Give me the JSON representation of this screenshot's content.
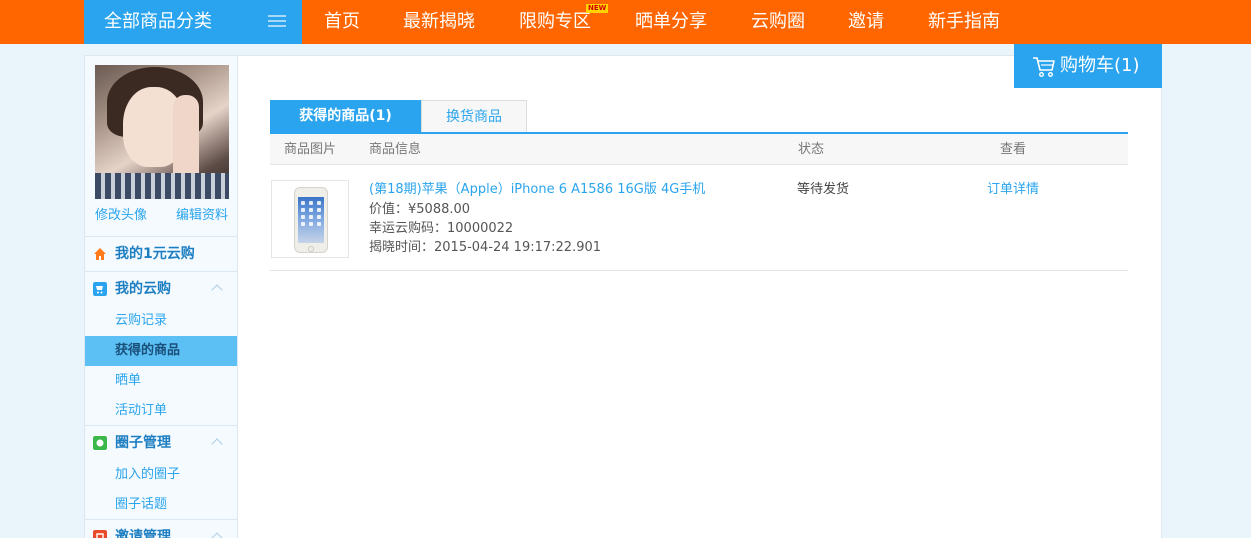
{
  "topbar": {
    "category_label": "全部商品分类",
    "nav": [
      {
        "label": "首页"
      },
      {
        "label": "最新揭晓"
      },
      {
        "label": "限购专区",
        "badge": "NEW"
      },
      {
        "label": "晒单分享"
      },
      {
        "label": "云购圈"
      },
      {
        "label": "邀请"
      },
      {
        "label": "新手指南"
      }
    ],
    "cart_label": "购物车(1)",
    "colors": {
      "bar": "#ff6600",
      "accent": "#2aa4ee"
    }
  },
  "sidebar": {
    "edit_avatar": "修改头像",
    "edit_profile": "编辑资料",
    "sections": [
      {
        "label": "我的1元云购",
        "icon": "home-icon",
        "items": []
      },
      {
        "label": "我的云购",
        "icon": "cart-icon",
        "items": [
          {
            "label": "云购记录"
          },
          {
            "label": "获得的商品",
            "active": true
          },
          {
            "label": "晒单"
          },
          {
            "label": "活动订单"
          }
        ]
      },
      {
        "label": "圈子管理",
        "icon": "circle-icon",
        "items": [
          {
            "label": "加入的圈子"
          },
          {
            "label": "圈子话题"
          }
        ]
      },
      {
        "label": "邀请管理",
        "icon": "invite-icon",
        "items": []
      }
    ]
  },
  "main": {
    "tabs": [
      {
        "label": "获得的商品(1)",
        "active": true
      },
      {
        "label": "换货商品",
        "active": false
      }
    ],
    "table": {
      "headers": [
        "商品图片",
        "商品信息",
        "状态",
        "查看"
      ],
      "rows": [
        {
          "title": "(第18期)苹果（Apple）iPhone 6 A1586 16G版 4G手机",
          "price": "价值：¥5088.00",
          "lucky_code": "幸运云购码：10000022",
          "reveal_time": "揭晓时间：2015-04-24 19:17:22.901",
          "status": "等待发货",
          "action": "订单详情"
        }
      ]
    }
  }
}
